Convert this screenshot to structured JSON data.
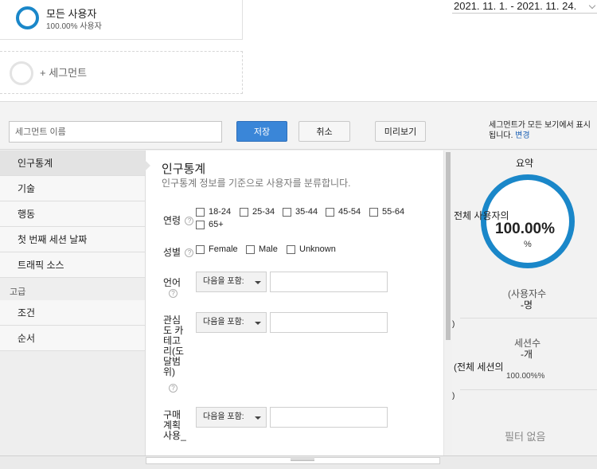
{
  "top": {
    "segment_name": "모든 사용자",
    "segment_sub": "100.00% 사용자",
    "add_segment": "+ 세그먼트",
    "date_range": "2021. 11. 1. - 2021. 11. 24."
  },
  "toolbar": {
    "name_placeholder": "세그먼트 이름",
    "save_label": "저장",
    "cancel_label": "취소",
    "preview_label": "미리보기",
    "note_text": "세그먼트가 모든 보기에서 표시됩니다.",
    "note_link": "변경"
  },
  "nav": {
    "items": [
      "인구통계",
      "기술",
      "행동",
      "첫 번째 세션 날짜",
      "트래픽 소스"
    ],
    "advanced_heading": "고급",
    "advanced_items": [
      "조건",
      "순서"
    ]
  },
  "main": {
    "title": "인구통계",
    "subtitle": "인구통계 정보를 기준으로 사용자를 분류합니다.",
    "age_label": "연령",
    "age_options": [
      "18-24",
      "25-34",
      "35-44",
      "45-54",
      "55-64",
      "65+"
    ],
    "gender_label": "성별",
    "gender_options": [
      "Female",
      "Male",
      "Unknown"
    ],
    "language_label": "언어",
    "interest_label": "관심도 카테고리(도달범위)",
    "interest_lines": [
      "관심",
      "도 카",
      "테고",
      "리(도",
      "달범",
      "위)"
    ],
    "purchase_lines": [
      "구매",
      "계획",
      "사용_"
    ],
    "select_value": "다음을 포함:",
    "help_glyph": "?"
  },
  "summary": {
    "title": "요약",
    "all_users_label": "전체 사용자의",
    "pct": "100.00%",
    "pct_sign": "%",
    "users_label": "(사용자수",
    "users_value": "-명",
    "paren": ")",
    "sessions_label": "세션수",
    "sessions_value": "-개",
    "all_sessions_label": "(전체 세션의",
    "all_sessions_pct": "100.00%%",
    "no_filter": "필터 없음"
  },
  "colors": {
    "accent": "#1a87c9",
    "save_button": "#3a86d8",
    "link": "#1a5fb4"
  }
}
